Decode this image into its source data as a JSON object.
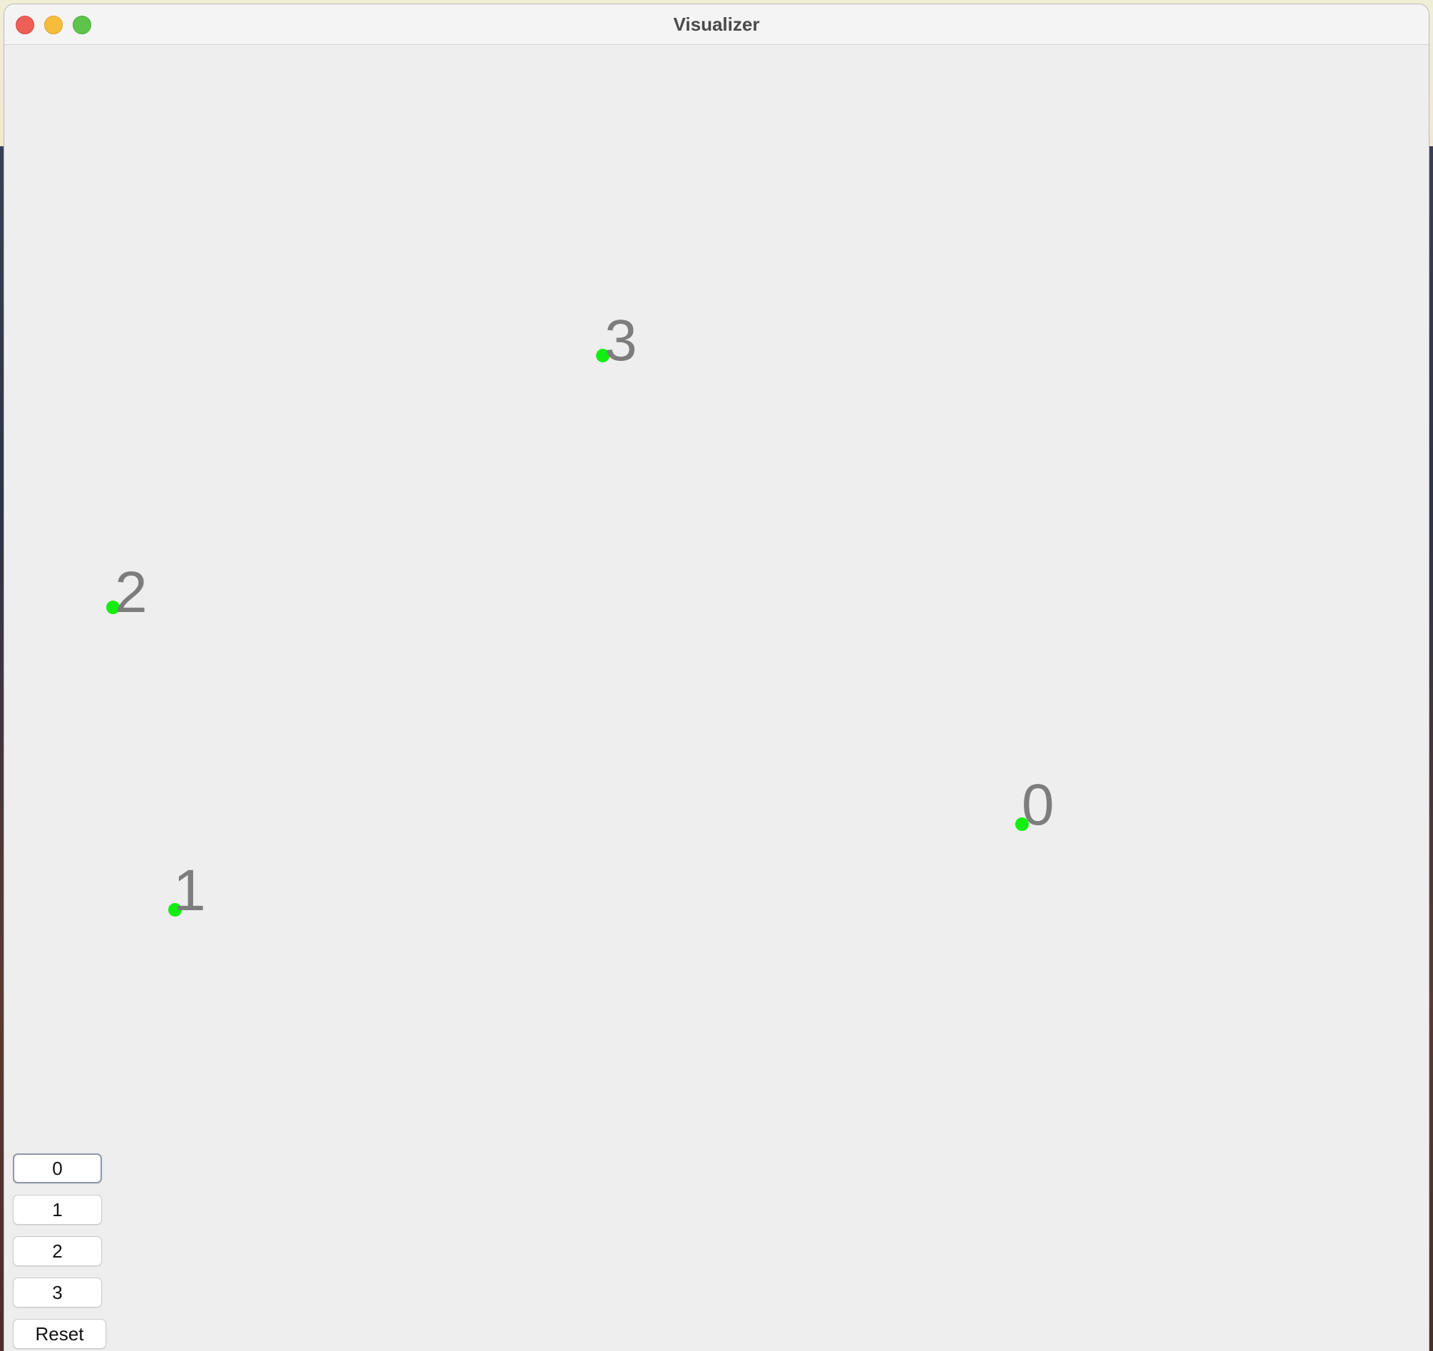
{
  "window": {
    "title": "Visualizer"
  },
  "points": [
    {
      "label": "0",
      "color": "#12ee12"
    },
    {
      "label": "1",
      "color": "#12ee12"
    },
    {
      "label": "2",
      "color": "#12ee12"
    },
    {
      "label": "3",
      "color": "#12ee12"
    }
  ],
  "buttons": {
    "b0": "0",
    "b1": "1",
    "b2": "2",
    "b3": "3",
    "reset": "Reset"
  },
  "colors": {
    "point": "#12ee12",
    "label": "#7d7d7d",
    "canvas": "#eeeeee"
  }
}
